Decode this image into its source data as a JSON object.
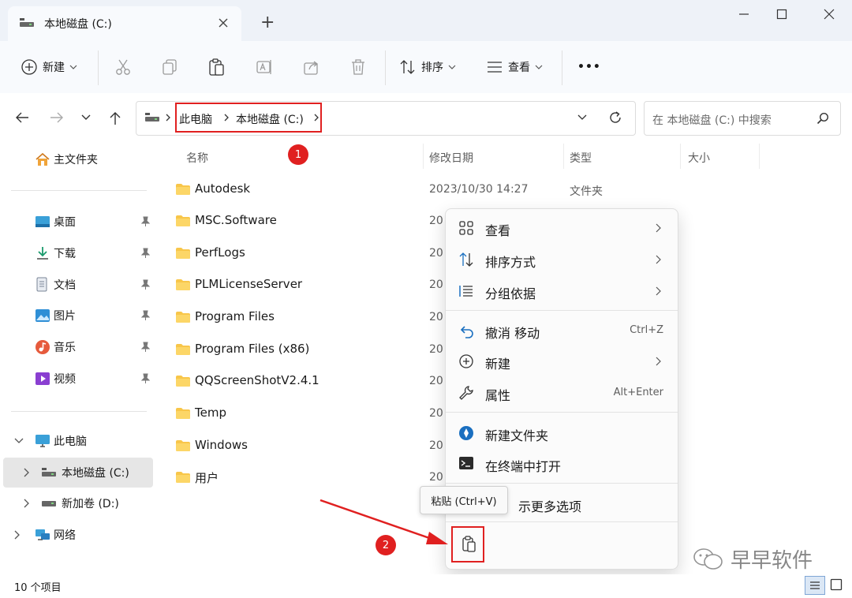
{
  "window": {
    "tab_title": "本地磁盘 (C:)",
    "new_tab_symbol": "+"
  },
  "toolbar": {
    "new_label": "新建",
    "sort_label": "排序",
    "view_label": "查看",
    "more_symbol": "•••"
  },
  "address": {
    "crumbs": [
      "此电脑",
      "本地磁盘 (C:)"
    ],
    "search_placeholder": "在 本地磁盘 (C:) 中搜索"
  },
  "nav": {
    "home": "主文件夹",
    "quick": [
      "桌面",
      "下载",
      "文档",
      "图片",
      "音乐",
      "视频"
    ],
    "this_pc": "此电脑",
    "drives": [
      "本地磁盘 (C:)",
      "新加卷 (D:)"
    ],
    "network": "网络"
  },
  "columns": {
    "name": "名称",
    "modified": "修改日期",
    "type": "类型",
    "size": "大小"
  },
  "files": [
    {
      "name": "Autodesk",
      "modified": "2023/10/30 14:27",
      "type": "文件夹"
    },
    {
      "name": "MSC.Software",
      "modified": "20"
    },
    {
      "name": "PerfLogs",
      "modified": "20"
    },
    {
      "name": "PLMLicenseServer",
      "modified": "20"
    },
    {
      "name": "Program Files",
      "modified": "20"
    },
    {
      "name": "Program Files (x86)",
      "modified": "20"
    },
    {
      "name": "QQScreenShotV2.4.1",
      "modified": "20"
    },
    {
      "name": "Temp",
      "modified": "20"
    },
    {
      "name": "Windows",
      "modified": "20"
    },
    {
      "name": "用户",
      "modified": "20"
    }
  ],
  "menu": {
    "view": "查看",
    "sort": "排序方式",
    "group": "分组依据",
    "undo": "撤消 移动",
    "undo_shortcut": "Ctrl+Z",
    "new": "新建",
    "properties": "属性",
    "properties_shortcut": "Alt+Enter",
    "new_folder": "新建文件夹",
    "terminal": "在终端中打开",
    "more_options": "示更多选项"
  },
  "tooltip": "粘贴 (Ctrl+V)",
  "status": {
    "count": "10 个项目"
  },
  "annotations": {
    "badge1": "1",
    "badge2": "2"
  },
  "watermark": "早早软件",
  "colors": {
    "accent": "#0067c0",
    "highlight": "#e02020",
    "folder": "#f8c64a"
  }
}
